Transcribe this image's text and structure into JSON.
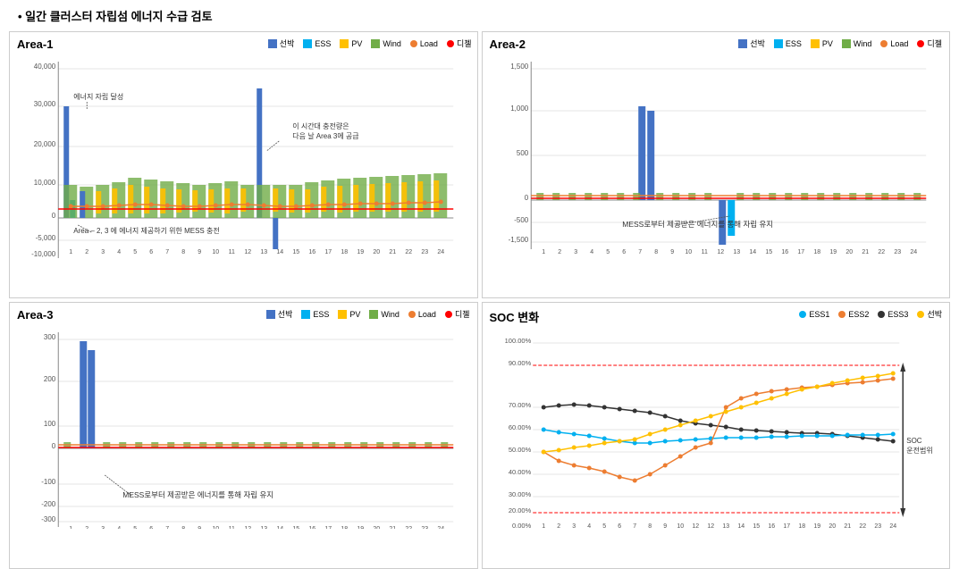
{
  "header": {
    "title": "• 일간 클러스터 자립섬 에너지 수급 검토"
  },
  "area1": {
    "title": "Area-1",
    "legend": [
      {
        "label": "선박",
        "color": "#4472C4",
        "type": "bar"
      },
      {
        "label": "ESS",
        "color": "#00B0F0",
        "type": "bar"
      },
      {
        "label": "PV",
        "color": "#FFC000",
        "type": "bar"
      },
      {
        "label": "Wind",
        "color": "#70AD47",
        "type": "bar"
      },
      {
        "label": "Load",
        "color": "#ED7D31",
        "type": "line"
      },
      {
        "label": "디젤",
        "color": "#FF0000",
        "type": "line"
      }
    ],
    "yMax": 40000,
    "yMin": -10000,
    "annotation1": "에너지 자립 달성",
    "annotation2": "이 시간대 충전량은\n다음 날 Area 3에 공급",
    "annotation3": "Area – 2, 3 에 에너지 제공하기 위한 MESS 충전"
  },
  "area2": {
    "title": "Area-2",
    "legend": [
      {
        "label": "선박",
        "color": "#4472C4",
        "type": "bar"
      },
      {
        "label": "ESS",
        "color": "#00B0F0",
        "type": "bar"
      },
      {
        "label": "PV",
        "color": "#FFC000",
        "type": "bar"
      },
      {
        "label": "Wind",
        "color": "#70AD47",
        "type": "bar"
      },
      {
        "label": "Load",
        "color": "#ED7D31",
        "type": "line"
      },
      {
        "label": "디젤",
        "color": "#FF0000",
        "type": "line"
      }
    ],
    "yMax": 1500,
    "yMin": -1500,
    "annotation1": "MESS로부터 제공받은 에너지를 통해 자립 유지"
  },
  "area3": {
    "title": "Area-3",
    "legend": [
      {
        "label": "선박",
        "color": "#4472C4",
        "type": "bar"
      },
      {
        "label": "ESS",
        "color": "#00B0F0",
        "type": "bar"
      },
      {
        "label": "PV",
        "color": "#FFC000",
        "type": "bar"
      },
      {
        "label": "Wind",
        "color": "#70AD47",
        "type": "bar"
      },
      {
        "label": "Load",
        "color": "#ED7D31",
        "type": "line"
      },
      {
        "label": "디젤",
        "color": "#FF0000",
        "type": "line"
      }
    ],
    "yMax": 300,
    "yMin": -300,
    "annotation1": "MESS로부터 제공받은 에너지를 통해 자립 유지"
  },
  "soc": {
    "title": "SOC 변화",
    "legend": [
      {
        "label": "ESS1",
        "color": "#00B0F0",
        "type": "line"
      },
      {
        "label": "ESS2",
        "color": "#ED7D31",
        "type": "line"
      },
      {
        "label": "ESS3",
        "color": "#333333",
        "type": "line"
      },
      {
        "label": "선박",
        "color": "#FFC000",
        "type": "line"
      }
    ],
    "yMax": "100.00%",
    "yMin": "0.00%",
    "annotation1": "SOC\n운전범위",
    "upperLimit": "90.00%",
    "lowerLimit": "20.00%"
  }
}
